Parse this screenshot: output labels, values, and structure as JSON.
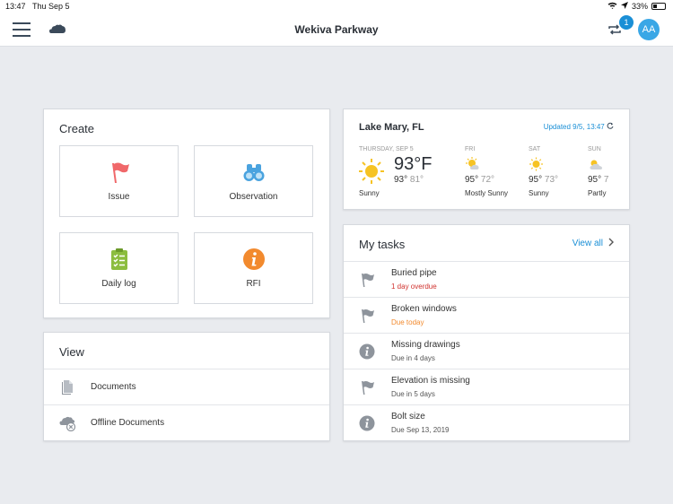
{
  "status": {
    "time": "13:47",
    "date": "Thu Sep 5",
    "battery": "33%"
  },
  "header": {
    "title": "Wekiva Parkway",
    "sync_badge": "1",
    "avatar": "AA"
  },
  "create": {
    "title": "Create",
    "tiles": [
      {
        "label": "Issue",
        "icon": "flag-icon",
        "color": "#f0686a"
      },
      {
        "label": "Observation",
        "icon": "binoculars-icon",
        "color": "#4aa3df"
      },
      {
        "label": "Daily log",
        "icon": "clipboard-icon",
        "color": "#8cbd3f"
      },
      {
        "label": "RFI",
        "icon": "info-icon",
        "color": "#f28a2e"
      }
    ]
  },
  "view": {
    "title": "View",
    "items": [
      {
        "label": "Documents",
        "icon": "document-icon"
      },
      {
        "label": "Offline Documents",
        "icon": "offline-cloud-icon"
      }
    ]
  },
  "weather": {
    "location": "Lake Mary, FL",
    "updated": "Updated 9/5, 13:47",
    "today": {
      "day": "THURSDAY, SEP 5",
      "temp": "93°F",
      "high": "93°",
      "low": "81°",
      "desc": "Sunny"
    },
    "forecast": [
      {
        "day": "FRI",
        "high": "95°",
        "low": "72°",
        "desc": "Mostly Sunny",
        "icon": "partly-sunny-icon"
      },
      {
        "day": "SAT",
        "high": "95°",
        "low": "73°",
        "desc": "Sunny",
        "icon": "sun-icon"
      },
      {
        "day": "SUN",
        "high": "95°",
        "low": "7",
        "desc": "Partly",
        "icon": "partly-cloudy-icon"
      }
    ]
  },
  "tasks": {
    "title": "My tasks",
    "view_all": "View all",
    "items": [
      {
        "title": "Buried pipe",
        "status": "1 day overdue",
        "status_color": "#d0322e",
        "icon": "flag-icon"
      },
      {
        "title": "Broken windows",
        "status": "Due today",
        "status_color": "#f28a2e",
        "icon": "flag-icon"
      },
      {
        "title": "Missing drawings",
        "status": "Due in 4 days",
        "status_color": "#555555",
        "icon": "info-icon"
      },
      {
        "title": "Elevation is missing",
        "status": "Due in 5 days",
        "status_color": "#555555",
        "icon": "flag-icon"
      },
      {
        "title": "Bolt size",
        "status": "Due Sep 13, 2019",
        "status_color": "#555555",
        "icon": "info-icon"
      }
    ]
  }
}
